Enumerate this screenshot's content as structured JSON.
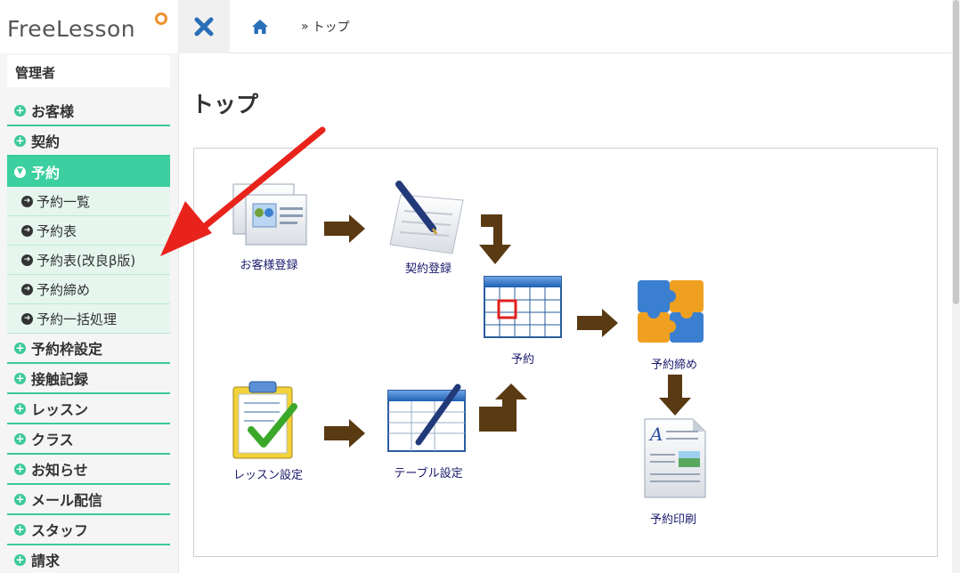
{
  "app": {
    "logo_text": "FreeLesson"
  },
  "header": {
    "breadcrumb_home_icon": "home-icon",
    "breadcrumb_separator": "»",
    "breadcrumb_current": "トップ",
    "close_icon": "close-icon"
  },
  "sidebar": {
    "user_label": "管理者",
    "items": [
      {
        "label": "お客様",
        "icon": "plus-circle-icon"
      },
      {
        "label": "契約",
        "icon": "plus-circle-icon"
      },
      {
        "label": "予約",
        "icon": "chevron-down-circle-icon",
        "active": true,
        "children": [
          {
            "label": "予約一覧",
            "icon": "arrow-right-circle-icon"
          },
          {
            "label": "予約表",
            "icon": "arrow-right-circle-icon"
          },
          {
            "label": "予約表(改良β版)",
            "icon": "arrow-right-circle-icon"
          },
          {
            "label": "予約締め",
            "icon": "arrow-right-circle-icon"
          },
          {
            "label": "予約一括処理",
            "icon": "arrow-right-circle-icon"
          }
        ]
      },
      {
        "label": "予約枠設定",
        "icon": "plus-circle-icon"
      },
      {
        "label": "接触記録",
        "icon": "plus-circle-icon"
      },
      {
        "label": "レッスン",
        "icon": "plus-circle-icon"
      },
      {
        "label": "クラス",
        "icon": "plus-circle-icon"
      },
      {
        "label": "お知らせ",
        "icon": "plus-circle-icon"
      },
      {
        "label": "メール配信",
        "icon": "plus-circle-icon"
      },
      {
        "label": "スタッフ",
        "icon": "plus-circle-icon"
      },
      {
        "label": "請求",
        "icon": "plus-circle-icon"
      }
    ]
  },
  "main": {
    "title": "トップ",
    "flow": {
      "customer_register": "お客様登録",
      "contract_register": "契約登録",
      "reservation": "予約",
      "reservation_close": "予約締め",
      "lesson_setting": "レッスン設定",
      "table_setting": "テーブル設定",
      "reservation_print": "予約印刷"
    }
  },
  "colors": {
    "accent": "#3ccf9f",
    "flow_arrow": "#5a3a12",
    "annotation_arrow": "#e8231c",
    "link_text": "#1b1b6e"
  }
}
